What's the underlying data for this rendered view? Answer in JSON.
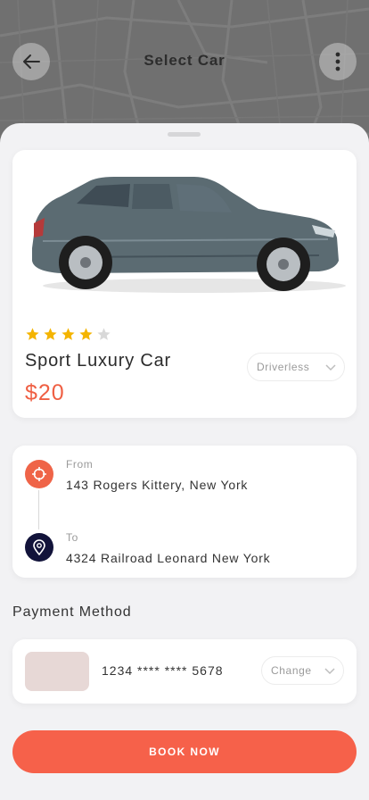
{
  "header": {
    "title": "Select Car",
    "back_icon": "arrow-left-icon",
    "menu_icon": "more-vertical-icon"
  },
  "car": {
    "name": "Sport Luxury Car",
    "price": "$20",
    "rating": 4,
    "rating_max": 5,
    "driver_option": "Driverless",
    "image_icon": "car-image"
  },
  "route": {
    "from_label": "From",
    "from_value": "143 Rogers Kittery, New York",
    "to_label": "To",
    "to_value": "4324 Railroad Leonard New York"
  },
  "payment": {
    "section_title": "Payment Method",
    "card_number": "1234 **** **** 5678",
    "change_label": "Change"
  },
  "actions": {
    "book_label": "BOOK NOW"
  },
  "colors": {
    "accent": "#f6614a",
    "price": "#ef5f43",
    "star": "#f4b400",
    "star_empty": "#d8d8d8",
    "to_icon_bg": "#12133a"
  }
}
